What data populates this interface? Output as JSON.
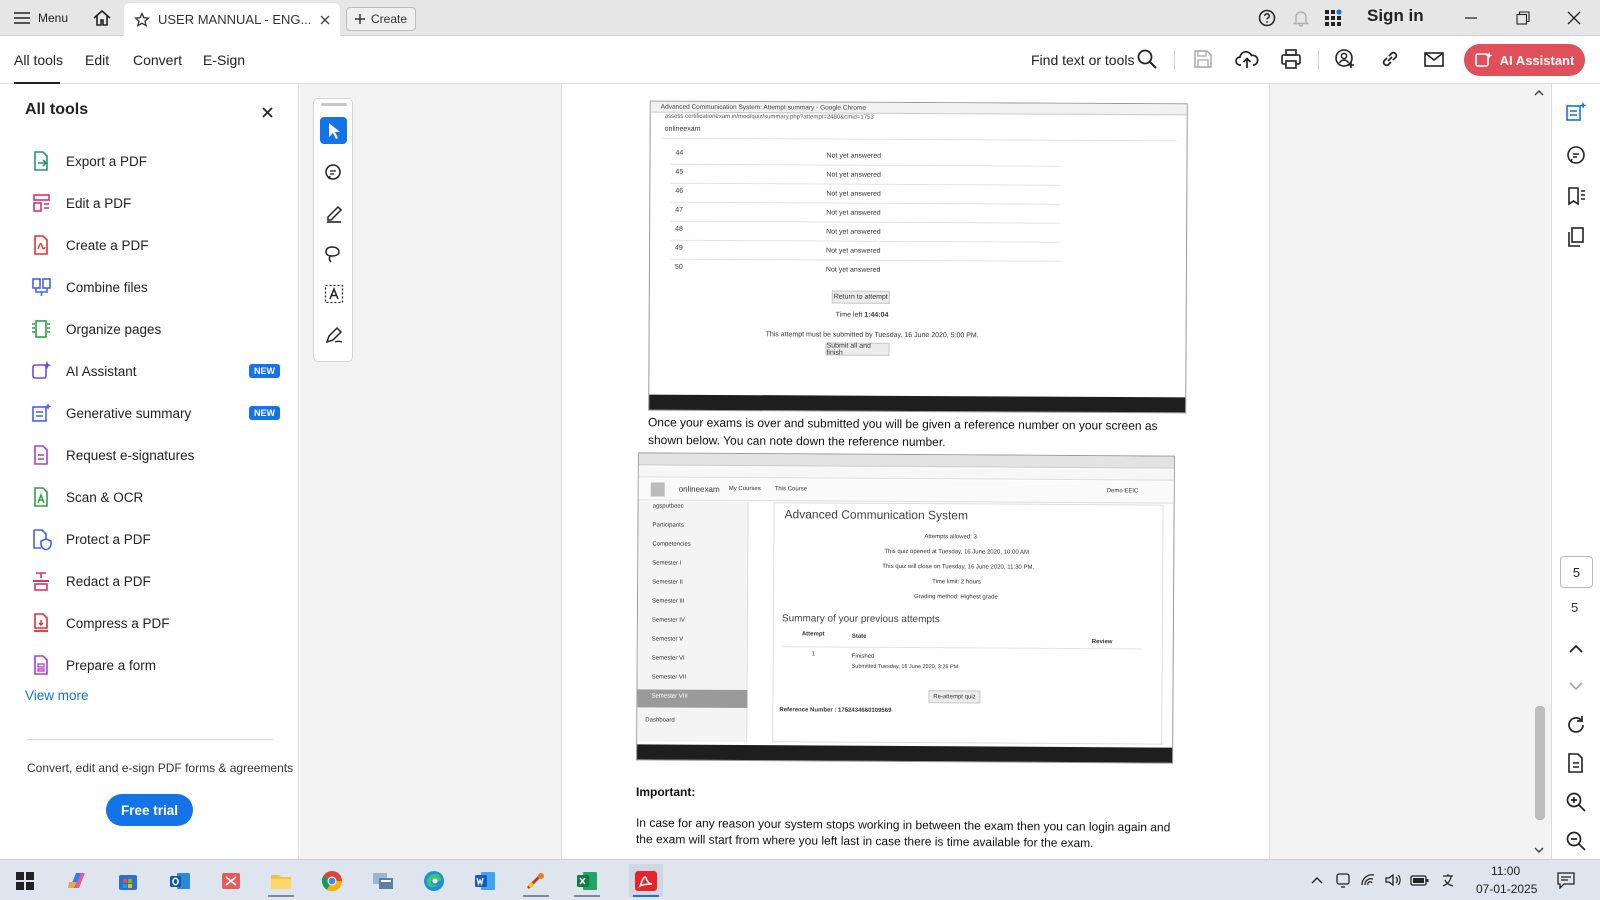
{
  "titlebar": {
    "menu_label": "Menu",
    "tab_title": "USER MANNUAL - ENG...",
    "create_label": "Create",
    "signin_label": "Sign in"
  },
  "toolbar": {
    "tabs": [
      "All tools",
      "Edit",
      "Convert",
      "E-Sign"
    ],
    "find_label": "Find text or tools",
    "ai_label": "AI Assistant"
  },
  "left_panel": {
    "title": "All tools",
    "items": [
      {
        "label": "Export a PDF",
        "icon": "export-pdf-icon",
        "color": "#1f9a6f"
      },
      {
        "label": "Edit a PDF",
        "icon": "edit-pdf-icon",
        "color": "#d6336c"
      },
      {
        "label": "Create a PDF",
        "icon": "create-pdf-icon",
        "color": "#e03131"
      },
      {
        "label": "Combine files",
        "icon": "combine-files-icon",
        "color": "#4263eb"
      },
      {
        "label": "Organize pages",
        "icon": "organize-pages-icon",
        "color": "#2f9e44"
      },
      {
        "label": "AI Assistant",
        "icon": "ai-assistant-icon",
        "color": "#7048e8",
        "badge": "NEW"
      },
      {
        "label": "Generative summary",
        "icon": "generative-summary-icon",
        "color": "#4263eb",
        "badge": "NEW"
      },
      {
        "label": "Request e-signatures",
        "icon": "request-esignatures-icon",
        "color": "#ae3ec9"
      },
      {
        "label": "Scan & OCR",
        "icon": "scan-ocr-icon",
        "color": "#2f9e44"
      },
      {
        "label": "Protect a PDF",
        "icon": "protect-pdf-icon",
        "color": "#4263eb"
      },
      {
        "label": "Redact a PDF",
        "icon": "redact-pdf-icon",
        "color": "#d6336c"
      },
      {
        "label": "Compress a PDF",
        "icon": "compress-pdf-icon",
        "color": "#e03131"
      },
      {
        "label": "Prepare a form",
        "icon": "prepare-form-icon",
        "color": "#ae3ec9"
      }
    ],
    "view_more": "View more",
    "promo": "Convert, edit and e-sign PDF forms & agreements",
    "trial_label": "Free trial"
  },
  "document": {
    "shot1": {
      "window_title": "Advanced Communication System: Attempt summary - Google Chrome",
      "url": "assess.certificationexam.in/mod/quiz/summary.php?attempt=2480&cmid=1753",
      "site": "onlineexam",
      "rows": [
        {
          "num": "44",
          "status": "Not yet answered"
        },
        {
          "num": "45",
          "status": "Not yet answered"
        },
        {
          "num": "46",
          "status": "Not yet answered"
        },
        {
          "num": "47",
          "status": "Not yet answered"
        },
        {
          "num": "48",
          "status": "Not yet answered"
        },
        {
          "num": "49",
          "status": "Not yet answered"
        },
        {
          "num": "50",
          "status": "Not yet answered"
        }
      ],
      "return_btn": "Return to attempt",
      "time_left_label": "Time left",
      "time_left": "1:44:04",
      "submit_note": "This attempt must be submitted by Tuesday, 16 June 2020, 5:00 PM.",
      "submit_btn": "Submit all and finish"
    },
    "paragraph1_line1": "Once your exams is over and submitted you will be given a reference number on your screen as",
    "paragraph1_line2": "shown below. You can note down the reference number.",
    "shot2": {
      "site": "onlineexam",
      "nav_my_courses": "My Courses",
      "nav_this_course": "This Course",
      "user": "Demo EEIC",
      "sidebar": [
        "agsputbeec",
        "Participants",
        "Competencies",
        "Semester I",
        "Semester II",
        "Semester III",
        "Semester IV",
        "Semester V",
        "Semester VI",
        "Semester VII",
        "Semester VIII",
        "Dashboard"
      ],
      "heading": "Advanced Communication System",
      "attempts_allowed": "Attempts allowed: 3",
      "opened": "This quiz opened at Tuesday, 16 June 2020, 10:00 AM",
      "closes": "This quiz will close on Tuesday, 16 June 2020, 11:30 PM.",
      "time_limit": "Time limit: 2 hours",
      "grading": "Grading method: Highest grade",
      "summary_heading": "Summary of your previous attempts",
      "col_attempt": "Attempt",
      "col_state": "State",
      "col_review": "Review",
      "attempt_num": "1",
      "state": "Finished",
      "submitted": "Submitted Tuesday, 16 June 2020, 3:26 PM",
      "reattempt_btn": "Re-attempt quiz",
      "reference": "Reference Number : 1752434660109569"
    },
    "important_heading": "Important:",
    "paragraph2_line1": "In case for any reason your system stops working in between the exam then you can login again and",
    "paragraph2_line2": "the exam will start from where you left last in case there is time available for the exam."
  },
  "right_rail": {
    "page_current": "5",
    "page_total": "5"
  },
  "taskbar": {
    "time": "11:00",
    "date": "07-01-2025"
  },
  "colors": {
    "accent": "#1473e6",
    "ai_button": "#e0505a"
  }
}
